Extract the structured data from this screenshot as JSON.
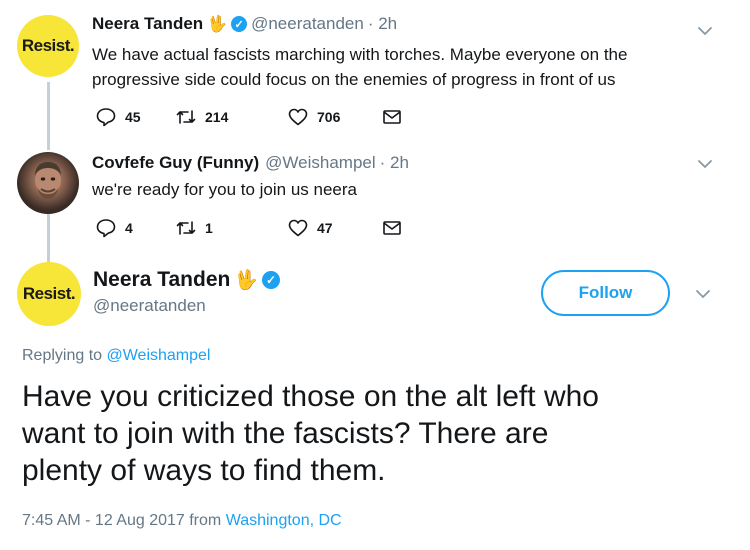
{
  "tweet1": {
    "avatar_text": "Resist.",
    "name": "Neera Tanden",
    "emoji": "🖖",
    "handle": "@neeratanden",
    "time": "· 2h",
    "text_line1": "We have actual fascists marching with torches. Maybe everyone on the",
    "text_line2": "progressive side could focus on the enemies of progress in front of us",
    "reply_count": "45",
    "retweet_count": "214",
    "like_count": "706"
  },
  "tweet2": {
    "name": "Covfefe Guy (Funny)",
    "handle": "@Weishampel",
    "time": "· 2h",
    "text": "we're ready for you to join us neera",
    "reply_count": "4",
    "retweet_count": "1",
    "like_count": "47"
  },
  "main_tweet": {
    "avatar_text": "Resist.",
    "name": "Neera Tanden",
    "emoji": "🖖",
    "handle": "@neeratanden",
    "follow_label": "Follow",
    "replying_prefix": "Replying to ",
    "replying_handle": "@Weishampel",
    "text_line1": "Have you criticized those on the alt left who",
    "text_line2": "want to join with the fascists? There are",
    "text_line3": "plenty of ways to find them.",
    "timestamp": "7:45 AM - 12 Aug 2017 from ",
    "location": "Washington, DC"
  },
  "colors": {
    "accent": "#1da1f2",
    "muted": "#657786",
    "resist_yellow": "#f7e538"
  }
}
